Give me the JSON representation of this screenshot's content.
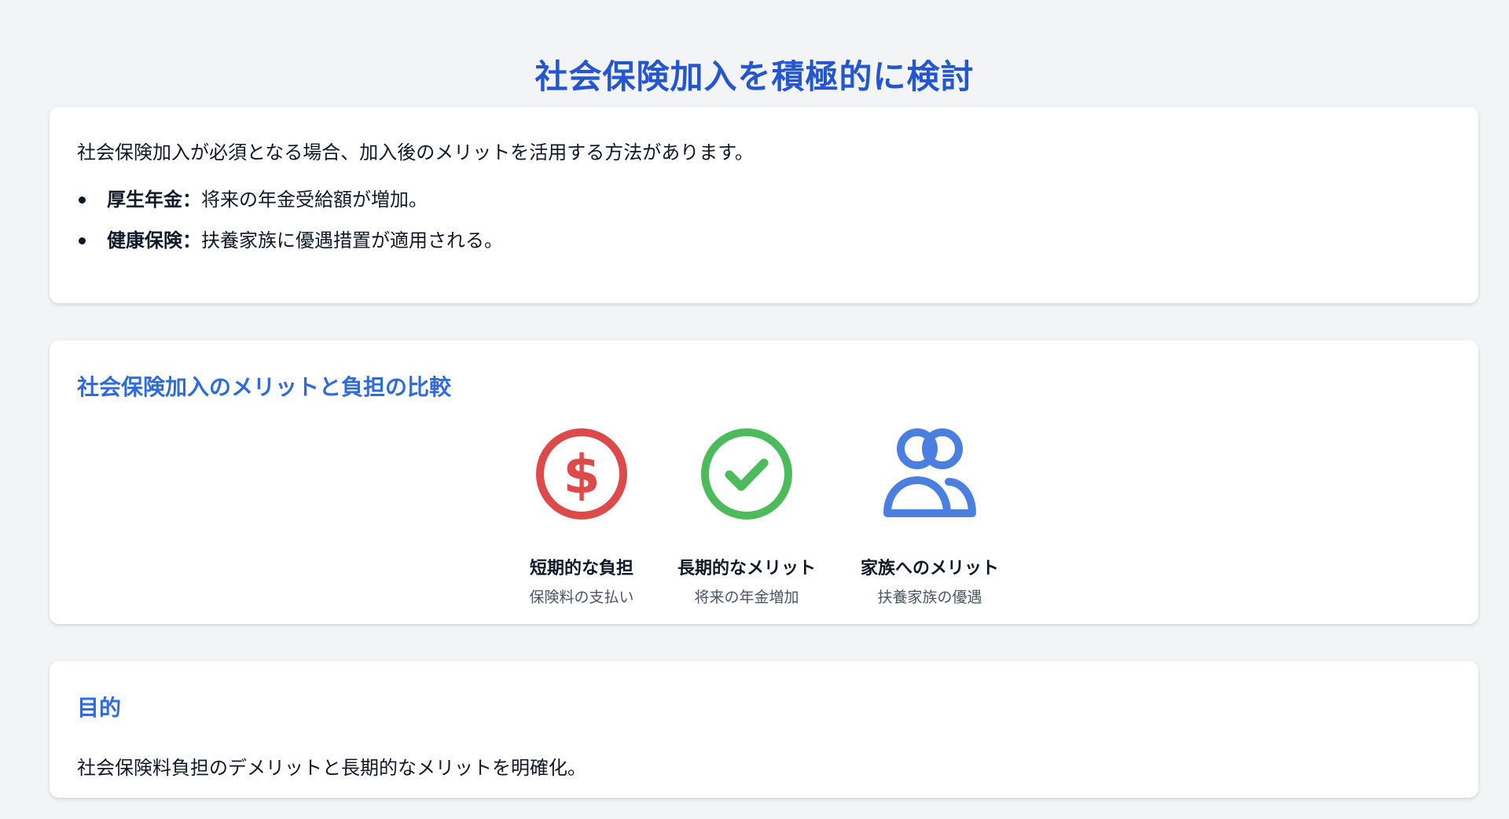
{
  "header": {
    "title": "社会保険加入を積極的に検討"
  },
  "intro": {
    "paragraph": "社会保険加入が必須となる場合、加入後のメリットを活用する方法があります。",
    "bullets": [
      {
        "term": "厚生年金：",
        "text": "将来の年金受給額が増加。"
      },
      {
        "term": "健康保険：",
        "text": "扶養家族に優遇措置が適用される。"
      }
    ]
  },
  "comparison": {
    "heading": "社会保険加入のメリットと負担の比較",
    "items": [
      {
        "icon": "dollar-circle-icon",
        "color": "#dc4a4a",
        "title": "短期的な負担",
        "subtitle": "保険料の支払い"
      },
      {
        "icon": "check-circle-icon",
        "color": "#4cbb5c",
        "title": "長期的なメリット",
        "subtitle": "将来の年金増加"
      },
      {
        "icon": "users-icon",
        "color": "#4a7fe0",
        "title": "家族へのメリット",
        "subtitle": "扶養家族の優遇"
      }
    ]
  },
  "purpose": {
    "heading": "目的",
    "text": "社会保険料負担のデメリットと長期的なメリットを明確化。"
  }
}
